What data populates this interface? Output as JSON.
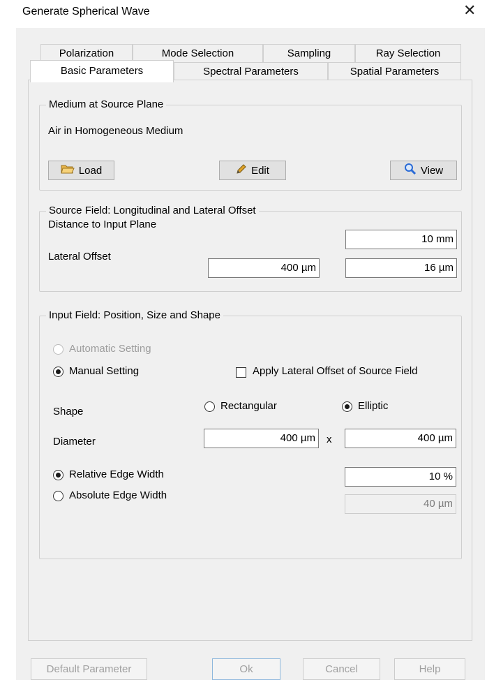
{
  "window": {
    "title": "Generate Spherical Wave",
    "close_glyph": "✕"
  },
  "tabs": {
    "row1": [
      "Polarization",
      "Mode Selection",
      "Sampling",
      "Ray Selection"
    ],
    "row2": [
      "Basic Parameters",
      "Spectral Parameters",
      "Spatial Parameters"
    ],
    "active": "Basic Parameters"
  },
  "medium": {
    "group_label": "Medium at Source Plane",
    "description": "Air in Homogeneous Medium",
    "load_label": "Load",
    "edit_label": "Edit",
    "view_label": "View",
    "icons": {
      "load": "folder-open-icon",
      "edit": "pencil-icon",
      "view": "magnifier-icon"
    }
  },
  "source_field": {
    "group_label": "Source Field: Longitudinal and Lateral Offset",
    "distance_label": "Distance to Input Plane",
    "distance_value": "10 mm",
    "lateral_label": "Lateral Offset",
    "lateral_x": "400 µm",
    "lateral_y": "16 µm"
  },
  "input_field": {
    "group_label": "Input Field: Position, Size and Shape",
    "automatic_label": "Automatic Setting",
    "manual_label": "Manual Setting",
    "apply_offset_label": "Apply Lateral Offset of Source Field",
    "shape_label": "Shape",
    "rectangular_label": "Rectangular",
    "elliptic_label": "Elliptic",
    "diameter_label": "Diameter",
    "diameter_x": "400 µm",
    "times_glyph": "x",
    "diameter_y": "400 µm",
    "relative_edge_label": "Relative Edge Width",
    "relative_edge_value": "10 %",
    "absolute_edge_label": "Absolute Edge Width",
    "absolute_edge_value": "40 µm"
  },
  "footer": {
    "default_label": "Default Parameter",
    "ok_label": "Ok",
    "cancel_label": "Cancel",
    "help_label": "Help"
  },
  "colors": {
    "accent": "#2a6bd6",
    "folder": "#e8b54a",
    "pencil": "#e0a32a"
  }
}
